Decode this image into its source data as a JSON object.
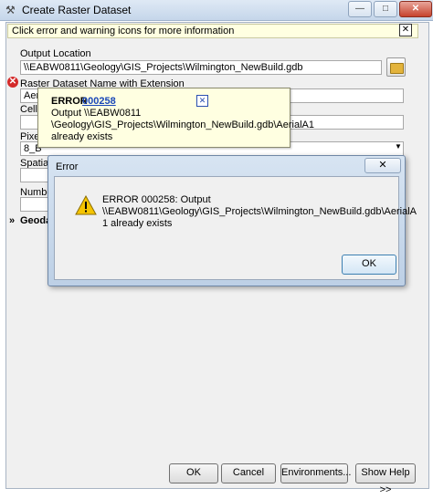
{
  "window": {
    "title": "Create Raster Dataset",
    "minimize_glyph": "—",
    "maximize_glyph": "□",
    "close_glyph": "✕"
  },
  "info_banner": {
    "text": "Click error and warning icons for more information",
    "close_glyph": "✕"
  },
  "form": {
    "output_location_label": "Output Location",
    "output_location_value": "\\\\EABW0811\\Geology\\GIS_Projects\\Wilmington_NewBuild.gdb",
    "raster_name_label": "Raster Dataset Name with Extension",
    "raster_name_value": "Aer",
    "cellsize_label": "Cells",
    "pixel_label": "Pixel",
    "pixel_value": "8_B",
    "spatial_label": "Spatial R",
    "number_label": "Number",
    "geodatabase_label": "Geoda",
    "chevron_glyph": "»"
  },
  "tooltip": {
    "title": "ERROR",
    "code_link": "000258",
    "close_glyph": "✕",
    "lines": [
      "Output \\\\EABW0811",
      "\\Geology\\GIS_Projects\\Wilmington_NewBuild.gdb\\AerialA1",
      "already exists"
    ]
  },
  "buttons": {
    "ok": "OK",
    "cancel": "Cancel",
    "environments": "Environments...",
    "show_help": "Show Help >>"
  },
  "error_dialog": {
    "title": "Error",
    "close_glyph": "✕",
    "lines": [
      "ERROR 000258: Output",
      "\\\\EABW0811\\Geology\\GIS_Projects\\Wilmington_NewBuild.gdb\\AerialA",
      "1 already exists"
    ],
    "ok": "OK"
  },
  "icons": {
    "error_icon": "error-icon",
    "warning_icon": "warning-icon",
    "folder_icon": "folder-icon",
    "tool_icon": "tool-icon"
  },
  "colors": {
    "tooltip_bg": "#ffffe1",
    "error_red": "#d42a2a",
    "link_blue": "#1a47b8",
    "warning_yellow": "#f5c400"
  }
}
